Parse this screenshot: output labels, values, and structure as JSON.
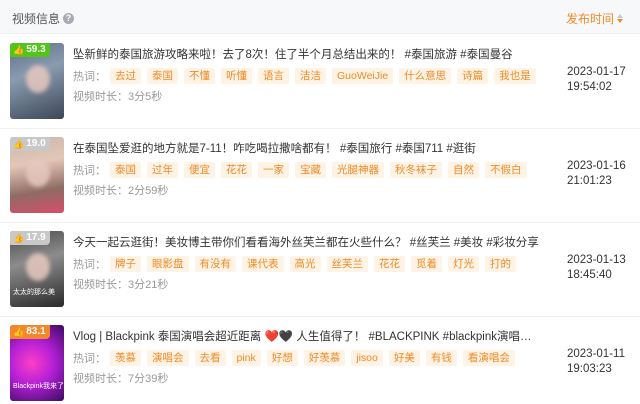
{
  "header": {
    "video_info_label": "视频信息",
    "help_icon": "?",
    "publish_time_label": "发布时间",
    "accent_color": "#f08a24"
  },
  "rows": [
    {
      "score": "59.3",
      "score_color": "#52c41a",
      "title": "坠新鲜的泰国旅游攻略来啦！去了8次！住了半个月总结出来的！ #泰国旅游 #泰国曼谷",
      "hot_label": "热词：",
      "tags": [
        "去过",
        "泰国",
        "不懂",
        "听懂",
        "语言",
        "洁洁",
        "GuoWeiJie",
        "什么意思",
        "诗篇",
        "我也是"
      ],
      "duration_label": "视频时长：",
      "duration": "3分5秒",
      "date": "2023-01-17",
      "time": "19:54:02"
    },
    {
      "score": "19.0",
      "score_color": "#c8c8c8",
      "title": "在泰国坠爱逛的地方就是7-11！咋吃喝拉撒啥都有！ #泰国旅行 #泰国711 #逛街",
      "hot_label": "热词：",
      "tags": [
        "泰国",
        "过年",
        "便宜",
        "花花",
        "一家",
        "宝藏",
        "光腿神器",
        "秋冬袜子",
        "自然",
        "不假白"
      ],
      "duration_label": "视频时长：",
      "duration": "2分59秒",
      "date": "2023-01-16",
      "time": "21:01:23"
    },
    {
      "score": "17.9",
      "score_color": "#c8c8c8",
      "title": "今天一起云逛街！美妆博主带你们看看海外丝芙兰都在火些什么？ #丝芙兰 #美妆 #彩妆分享",
      "hot_label": "热词：",
      "tags": [
        "牌子",
        "眼影盘",
        "有没有",
        "课代表",
        "高光",
        "丝芙兰",
        "花花",
        "觅着",
        "灯光",
        "打的"
      ],
      "duration_label": "视频时长：",
      "duration": "3分21秒",
      "date": "2023-01-13",
      "time": "18:45:40",
      "thumb_caption": "太太的那么美"
    },
    {
      "score": "83.1",
      "score_color": "#f5862a",
      "title": "Vlog | Blackpink 泰国演唱会超近距离 ❤️🖤 人生值得了！ #BLACKPINK #blackpink演唱会 #blackpink...",
      "hot_label": "热词：",
      "tags": [
        "羡慕",
        "演唱会",
        "去看",
        "pink",
        "好想",
        "好羡慕",
        "jisoo",
        "好美",
        "有钱",
        "看演唱会"
      ],
      "duration_label": "视频时长：",
      "duration": "7分39秒",
      "date": "2023-01-11",
      "time": "19:03:23",
      "thumb_caption": "Blackpink我来了"
    }
  ]
}
